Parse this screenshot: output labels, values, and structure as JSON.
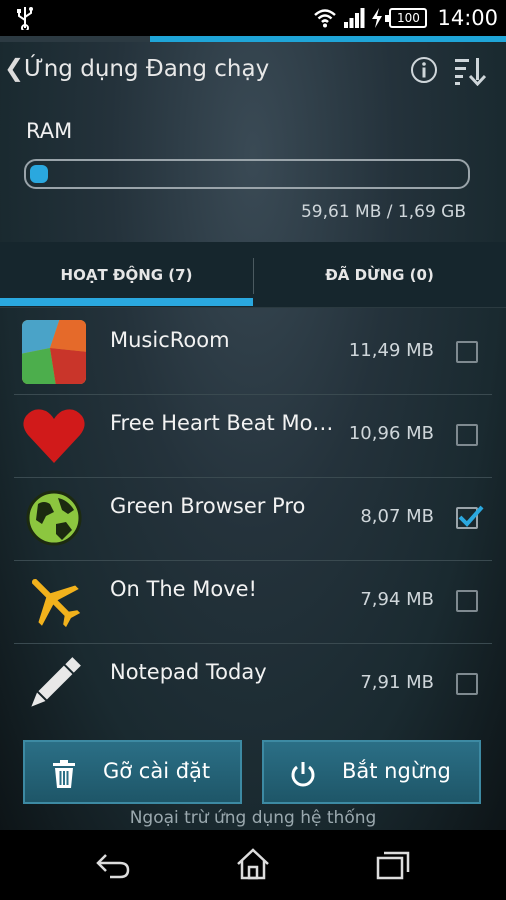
{
  "status_bar": {
    "battery": "100",
    "time": "14:00"
  },
  "header": {
    "title": "Ứng dụng Đang chạy"
  },
  "ram": {
    "label": "RAM",
    "usage_text": "59,61 MB / 1,69 GB",
    "fraction": 0.034
  },
  "tabs": [
    {
      "label": "HOẠT ĐỘNG (7)",
      "active": true
    },
    {
      "label": "ĐÃ DỪNG (0)",
      "active": false
    }
  ],
  "apps": [
    {
      "name": "MusicRoom",
      "size": "11,49 MB",
      "checked": false,
      "icon": "musicroom-icon"
    },
    {
      "name": "Free Heart Beat Mo…",
      "size": "10,96 MB",
      "checked": false,
      "icon": "heart-icon"
    },
    {
      "name": "Green Browser Pro",
      "size": "8,07 MB",
      "checked": true,
      "icon": "globe-icon"
    },
    {
      "name": "On The Move!",
      "size": "7,94 MB",
      "checked": false,
      "icon": "airplane-icon"
    },
    {
      "name": "Notepad Today",
      "size": "7,91 MB",
      "checked": false,
      "icon": "pencil-icon"
    }
  ],
  "actions": {
    "uninstall_label": "Gỡ cài đặt",
    "stop_label": "Bắt ngừng",
    "note": "Ngoại trừ ứng dụng hệ thống"
  },
  "colors": {
    "accent": "#2aa8df",
    "button": "#2b6f86"
  }
}
